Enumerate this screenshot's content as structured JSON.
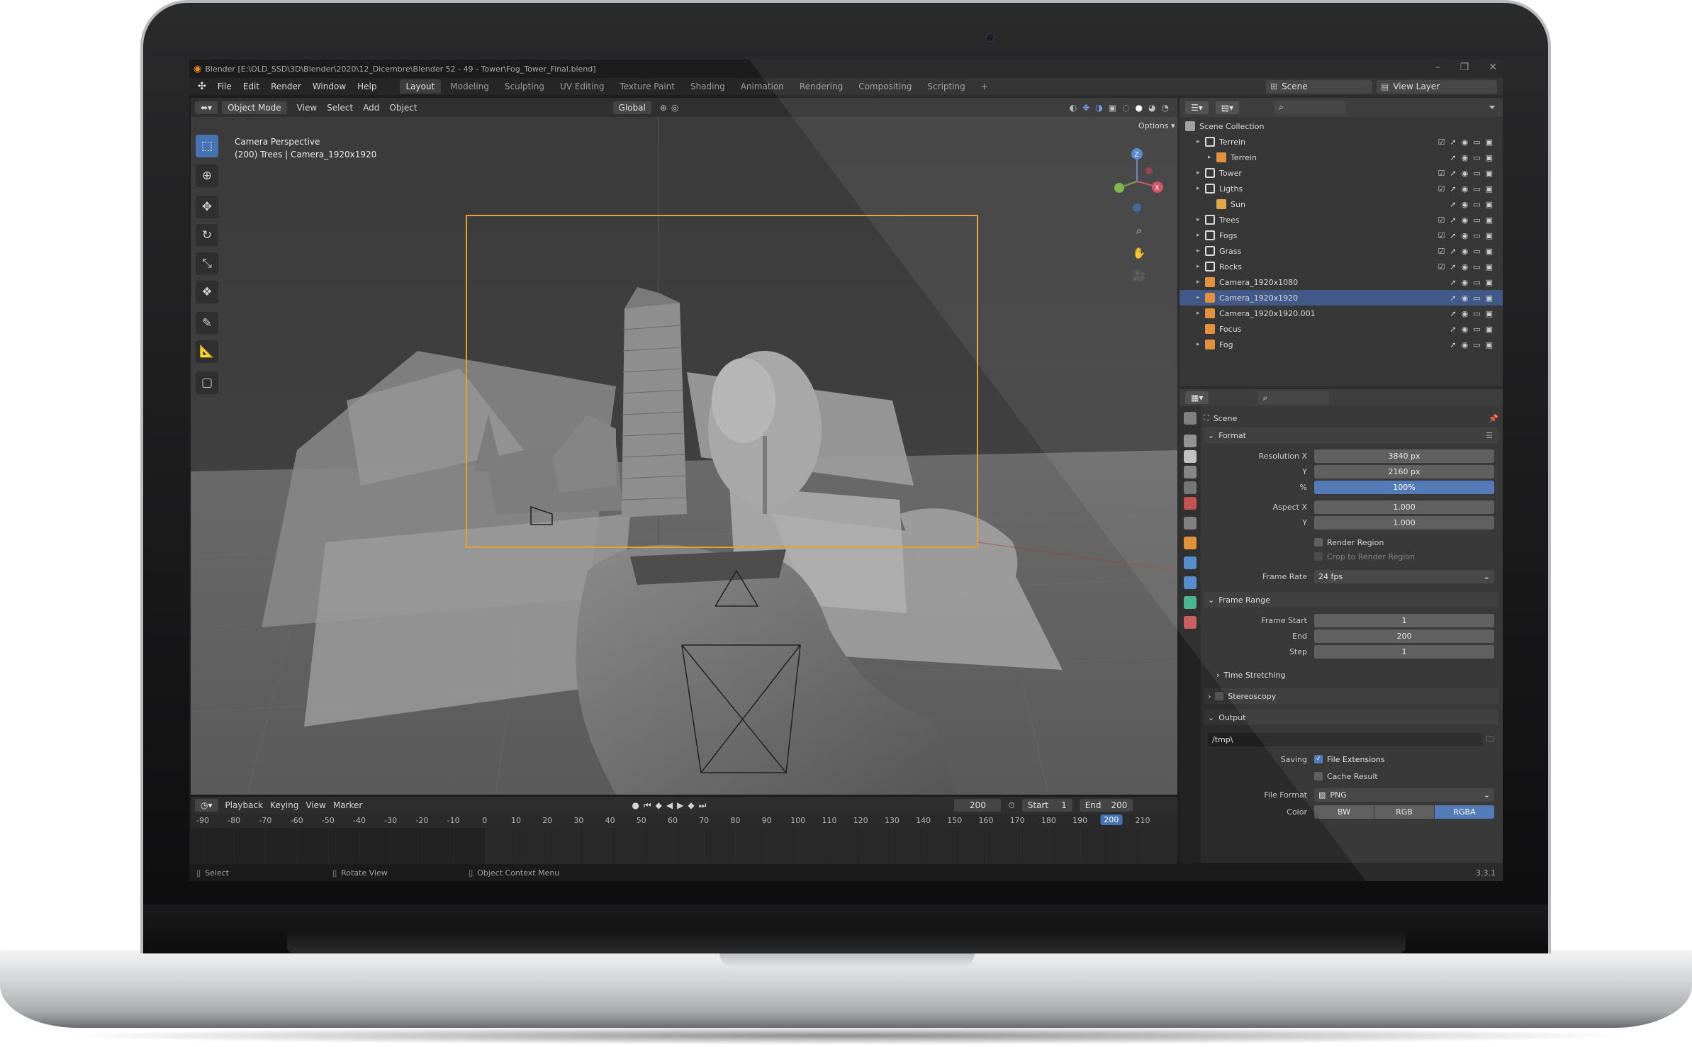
{
  "window": {
    "title": "Blender [E:\\OLD_SSD\\3D\\Blender\\2020\\12_Dicembre\\Blender 52 - 49 - Tower\\Fog_Tower_Final.blend]",
    "controls": [
      "–",
      "❐",
      "✕"
    ]
  },
  "menu": {
    "items": [
      "File",
      "Edit",
      "Render",
      "Window",
      "Help"
    ],
    "workspaces": [
      "Layout",
      "Modeling",
      "Sculpting",
      "UV Editing",
      "Texture Paint",
      "Shading",
      "Animation",
      "Rendering",
      "Compositing",
      "Scripting"
    ],
    "active_workspace": "Layout",
    "add_tab": "+",
    "scene_label": "Scene",
    "view_layer_label": "View Layer"
  },
  "viewport": {
    "mode": "Object Mode",
    "menus": [
      "View",
      "Select",
      "Add",
      "Object"
    ],
    "transform_orientation": "Global",
    "options_label": "Options",
    "info_line1": "Camera Perspective",
    "info_line2": "(200) Trees | Camera_1920x1920",
    "tools": [
      "select-box-icon",
      "cursor-icon",
      "move-icon",
      "rotate-icon",
      "scale-icon",
      "transform-icon",
      "annotate-icon",
      "measure-icon",
      "add-cube-icon"
    ],
    "gizmo_axes": [
      "Z",
      "X"
    ]
  },
  "timeline": {
    "menus": [
      "Playback",
      "Keying",
      "View",
      "Marker"
    ],
    "current_frame": "200",
    "start_label": "Start",
    "start_value": "1",
    "end_label": "End",
    "end_value": "200",
    "ticks": [
      "-90",
      "-80",
      "-70",
      "-60",
      "-50",
      "-40",
      "-30",
      "-20",
      "-10",
      "0",
      "10",
      "20",
      "30",
      "40",
      "50",
      "60",
      "70",
      "80",
      "90",
      "100",
      "110",
      "120",
      "130",
      "140",
      "150",
      "160",
      "170",
      "180",
      "190",
      "200",
      "210"
    ],
    "playhead": "200"
  },
  "statusbar": {
    "select": "Select",
    "rotate": "Rotate View",
    "context": "Object Context Menu",
    "version": "3.3.1"
  },
  "outliner": {
    "root": "Scene Collection",
    "rows": [
      {
        "label": "Terrein",
        "depth": 1,
        "kind": "collection",
        "selected": false
      },
      {
        "label": "Terrein",
        "depth": 2,
        "kind": "mesh",
        "selected": false
      },
      {
        "label": "Tower",
        "depth": 1,
        "kind": "collection",
        "selected": false
      },
      {
        "label": "Ligths",
        "depth": 1,
        "kind": "collection",
        "selected": false
      },
      {
        "label": "Sun",
        "depth": 2,
        "kind": "light",
        "selected": false
      },
      {
        "label": "Trees",
        "depth": 1,
        "kind": "collection",
        "selected": false
      },
      {
        "label": "Fogs",
        "depth": 1,
        "kind": "collection",
        "selected": false
      },
      {
        "label": "Grass",
        "depth": 1,
        "kind": "collection",
        "selected": false
      },
      {
        "label": "Rocks",
        "depth": 1,
        "kind": "collection",
        "selected": false
      },
      {
        "label": "Camera_1920x1080",
        "depth": 1,
        "kind": "camera",
        "selected": false
      },
      {
        "label": "Camera_1920x1920",
        "depth": 1,
        "kind": "camera",
        "selected": true
      },
      {
        "label": "Camera_1920x1920.001",
        "depth": 1,
        "kind": "camera",
        "selected": false
      },
      {
        "label": "Focus",
        "depth": 1,
        "kind": "empty",
        "selected": false
      },
      {
        "label": "Fog",
        "depth": 1,
        "kind": "mesh",
        "selected": false
      }
    ]
  },
  "properties": {
    "context": "Scene",
    "format_section": "Format",
    "resolution_x_label": "Resolution X",
    "resolution_x": "3840 px",
    "resolution_y_label": "Y",
    "resolution_y": "2160 px",
    "percent_label": "%",
    "percent": "100%",
    "aspect_x_label": "Aspect X",
    "aspect_x": "1.000",
    "aspect_y_label": "Y",
    "aspect_y": "1.000",
    "render_region": "Render Region",
    "crop_region": "Crop to Render Region",
    "frame_rate_label": "Frame Rate",
    "frame_rate": "24 fps",
    "frame_range_section": "Frame Range",
    "frame_start_label": "Frame Start",
    "frame_start": "1",
    "frame_end_label": "End",
    "frame_end": "200",
    "step_label": "Step",
    "step": "1",
    "time_stretching": "Time Stretching",
    "stereoscopy": "Stereoscopy",
    "output_section": "Output",
    "output_path": "/tmp\\",
    "saving_label": "Saving",
    "file_extensions": "File Extensions",
    "cache_result": "Cache Result",
    "file_format_label": "File Format",
    "file_format": "PNG",
    "color_label": "Color",
    "color_options": [
      "BW",
      "RGB",
      "RGBA"
    ],
    "color_selected": "RGBA"
  },
  "colors": {
    "accent": "#4772b3",
    "selection": "#334d80",
    "camera_frame": "#e5a133"
  }
}
